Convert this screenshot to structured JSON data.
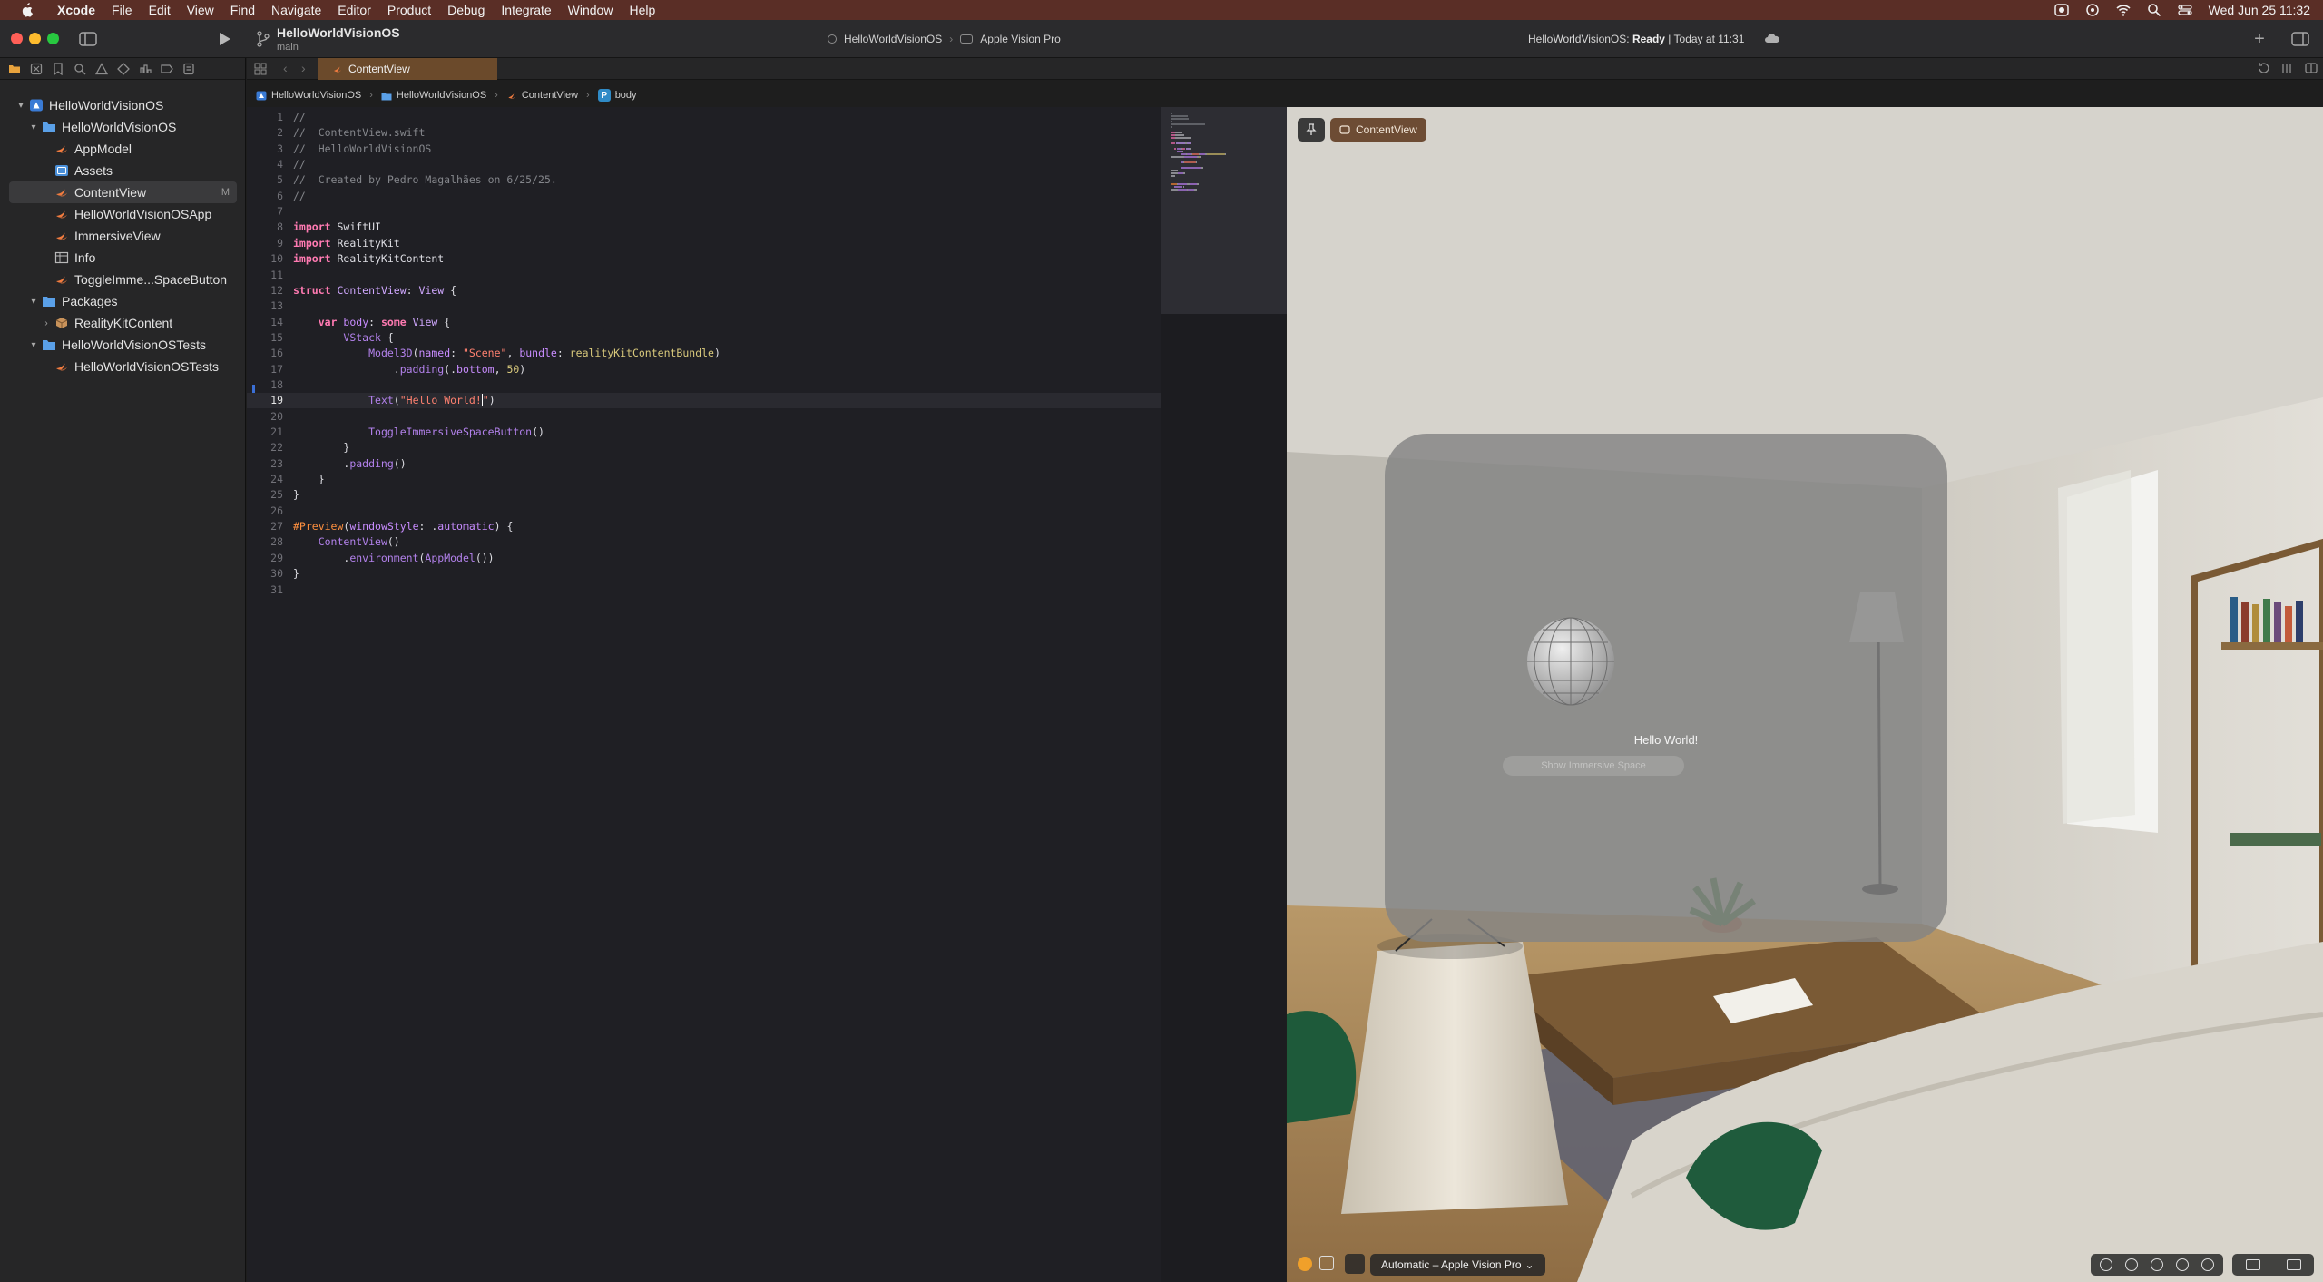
{
  "menubar": {
    "app": "Xcode",
    "items": [
      "File",
      "Edit",
      "View",
      "Find",
      "Navigate",
      "Editor",
      "Product",
      "Debug",
      "Integrate",
      "Window",
      "Help"
    ],
    "clock": "Wed Jun 25  11:32"
  },
  "toolbar": {
    "project": "HelloWorldVisionOS",
    "branch": "main",
    "scheme": "HelloWorldVisionOS",
    "device": "Apple Vision Pro",
    "status_prefix": "HelloWorldVisionOS: ",
    "status_state": "Ready",
    "status_suffix": " | Today at 11:31",
    "add": "+"
  },
  "navigator": {
    "items": [
      {
        "label": "HelloWorldVisionOS",
        "icon": "project-icon",
        "level": 0,
        "disclosure": "▾"
      },
      {
        "label": "HelloWorldVisionOS",
        "icon": "folder-icon",
        "level": 1,
        "disclosure": "▾"
      },
      {
        "label": "AppModel",
        "icon": "swift-file-icon",
        "level": 2,
        "disclosure": ""
      },
      {
        "label": "Assets",
        "icon": "asset-catalog-icon",
        "level": 2,
        "disclosure": ""
      },
      {
        "label": "ContentView",
        "icon": "swift-file-icon",
        "level": 2,
        "disclosure": "",
        "selected": true,
        "badge": "M"
      },
      {
        "label": "HelloWorldVisionOSApp",
        "icon": "swift-file-icon",
        "level": 2,
        "disclosure": ""
      },
      {
        "label": "ImmersiveView",
        "icon": "swift-file-icon",
        "level": 2,
        "disclosure": ""
      },
      {
        "label": "Info",
        "icon": "plist-icon",
        "level": 2,
        "disclosure": ""
      },
      {
        "label": "ToggleImme...SpaceButton",
        "icon": "swift-file-icon",
        "level": 2,
        "disclosure": ""
      },
      {
        "label": "Packages",
        "icon": "folder-icon",
        "level": 1,
        "disclosure": "▾"
      },
      {
        "label": "RealityKitContent",
        "icon": "package-icon",
        "level": 2,
        "disclosure": "›"
      },
      {
        "label": "HelloWorldVisionOSTests",
        "icon": "folder-icon",
        "level": 1,
        "disclosure": "▾"
      },
      {
        "label": "HelloWorldVisionOSTests",
        "icon": "swift-file-icon",
        "level": 2,
        "disclosure": ""
      }
    ]
  },
  "editor": {
    "tab": "ContentView",
    "breadcrumb": [
      "HelloWorldVisionOS",
      "HelloWorldVisionOS",
      "ContentView",
      "body"
    ],
    "breadcrumb_badge": "P",
    "current_line": 19,
    "lines": [
      [
        [
          "c",
          "//"
        ]
      ],
      [
        [
          "c",
          "//  ContentView.swift"
        ]
      ],
      [
        [
          "c",
          "//  HelloWorldVisionOS"
        ]
      ],
      [
        [
          "c",
          "//"
        ]
      ],
      [
        [
          "c",
          "//  Created by Pedro Magalhães on 6/25/25."
        ]
      ],
      [
        [
          "c",
          "//"
        ]
      ],
      [],
      [
        [
          "k",
          "import"
        ],
        [
          "",
          " SwiftUI"
        ]
      ],
      [
        [
          "k",
          "import"
        ],
        [
          "",
          " RealityKit"
        ]
      ],
      [
        [
          "k",
          "import"
        ],
        [
          "",
          " RealityKitContent"
        ]
      ],
      [],
      [
        [
          "k",
          "struct"
        ],
        [
          "",
          " "
        ],
        [
          "t",
          "ContentView"
        ],
        [
          "",
          ": "
        ],
        [
          "t",
          "View"
        ],
        [
          "",
          " {"
        ]
      ],
      [],
      [
        [
          "",
          "    "
        ],
        [
          "k",
          "var"
        ],
        [
          "",
          " "
        ],
        [
          "a",
          "body"
        ],
        [
          "",
          ": "
        ],
        [
          "k",
          "some"
        ],
        [
          "",
          " "
        ],
        [
          "t",
          "View"
        ],
        [
          "",
          " {"
        ]
      ],
      [
        [
          "",
          "        "
        ],
        [
          "f",
          "VStack"
        ],
        [
          "",
          " {"
        ]
      ],
      [
        [
          "",
          "            "
        ],
        [
          "f",
          "Model3D"
        ],
        [
          "",
          "("
        ],
        [
          "a",
          "named"
        ],
        [
          "",
          ": "
        ],
        [
          "s",
          "\"Scene\""
        ],
        [
          "",
          ", "
        ],
        [
          "a",
          "bundle"
        ],
        [
          "",
          ": "
        ],
        [
          "n",
          "realityKitContentBundle"
        ],
        [
          "",
          ")"
        ]
      ],
      [
        [
          "",
          "                ."
        ],
        [
          "f",
          "padding"
        ],
        [
          "",
          "(."
        ],
        [
          "a",
          "bottom"
        ],
        [
          "",
          ", "
        ],
        [
          "n",
          "50"
        ],
        [
          "",
          ")"
        ]
      ],
      [],
      [
        [
          "",
          "            "
        ],
        [
          "f",
          "Text"
        ],
        [
          "",
          "("
        ],
        [
          "s",
          "\"Hello World!"
        ],
        [
          "cursor",
          ""
        ],
        [
          "s",
          "\""
        ],
        [
          "",
          ")"
        ]
      ],
      [],
      [
        [
          "",
          "            "
        ],
        [
          "f",
          "ToggleImmersiveSpaceButton"
        ],
        [
          "",
          "()"
        ]
      ],
      [
        [
          "",
          "        }"
        ]
      ],
      [
        [
          "",
          "        ."
        ],
        [
          "f",
          "padding"
        ],
        [
          "",
          "()"
        ]
      ],
      [
        [
          "",
          "    }"
        ]
      ],
      [
        [
          "",
          "}"
        ]
      ],
      [],
      [
        [
          "m",
          "#Preview"
        ],
        [
          "",
          "("
        ],
        [
          "a",
          "windowStyle"
        ],
        [
          "",
          ": ."
        ],
        [
          "a",
          "automatic"
        ],
        [
          "",
          ") {"
        ]
      ],
      [
        [
          "",
          "    "
        ],
        [
          "f",
          "ContentView"
        ],
        [
          "",
          "()"
        ]
      ],
      [
        [
          "",
          "        ."
        ],
        [
          "f",
          "environment"
        ],
        [
          "",
          "("
        ],
        [
          "f",
          "AppModel"
        ],
        [
          "",
          "())"
        ]
      ],
      [
        [
          "",
          "}"
        ]
      ],
      []
    ]
  },
  "preview": {
    "label": "ContentView",
    "hello": "Hello World!",
    "button": "Show Immersive Space",
    "device_menu": "Automatic – Apple Vision Pro",
    "device_chevron": "⌄"
  }
}
